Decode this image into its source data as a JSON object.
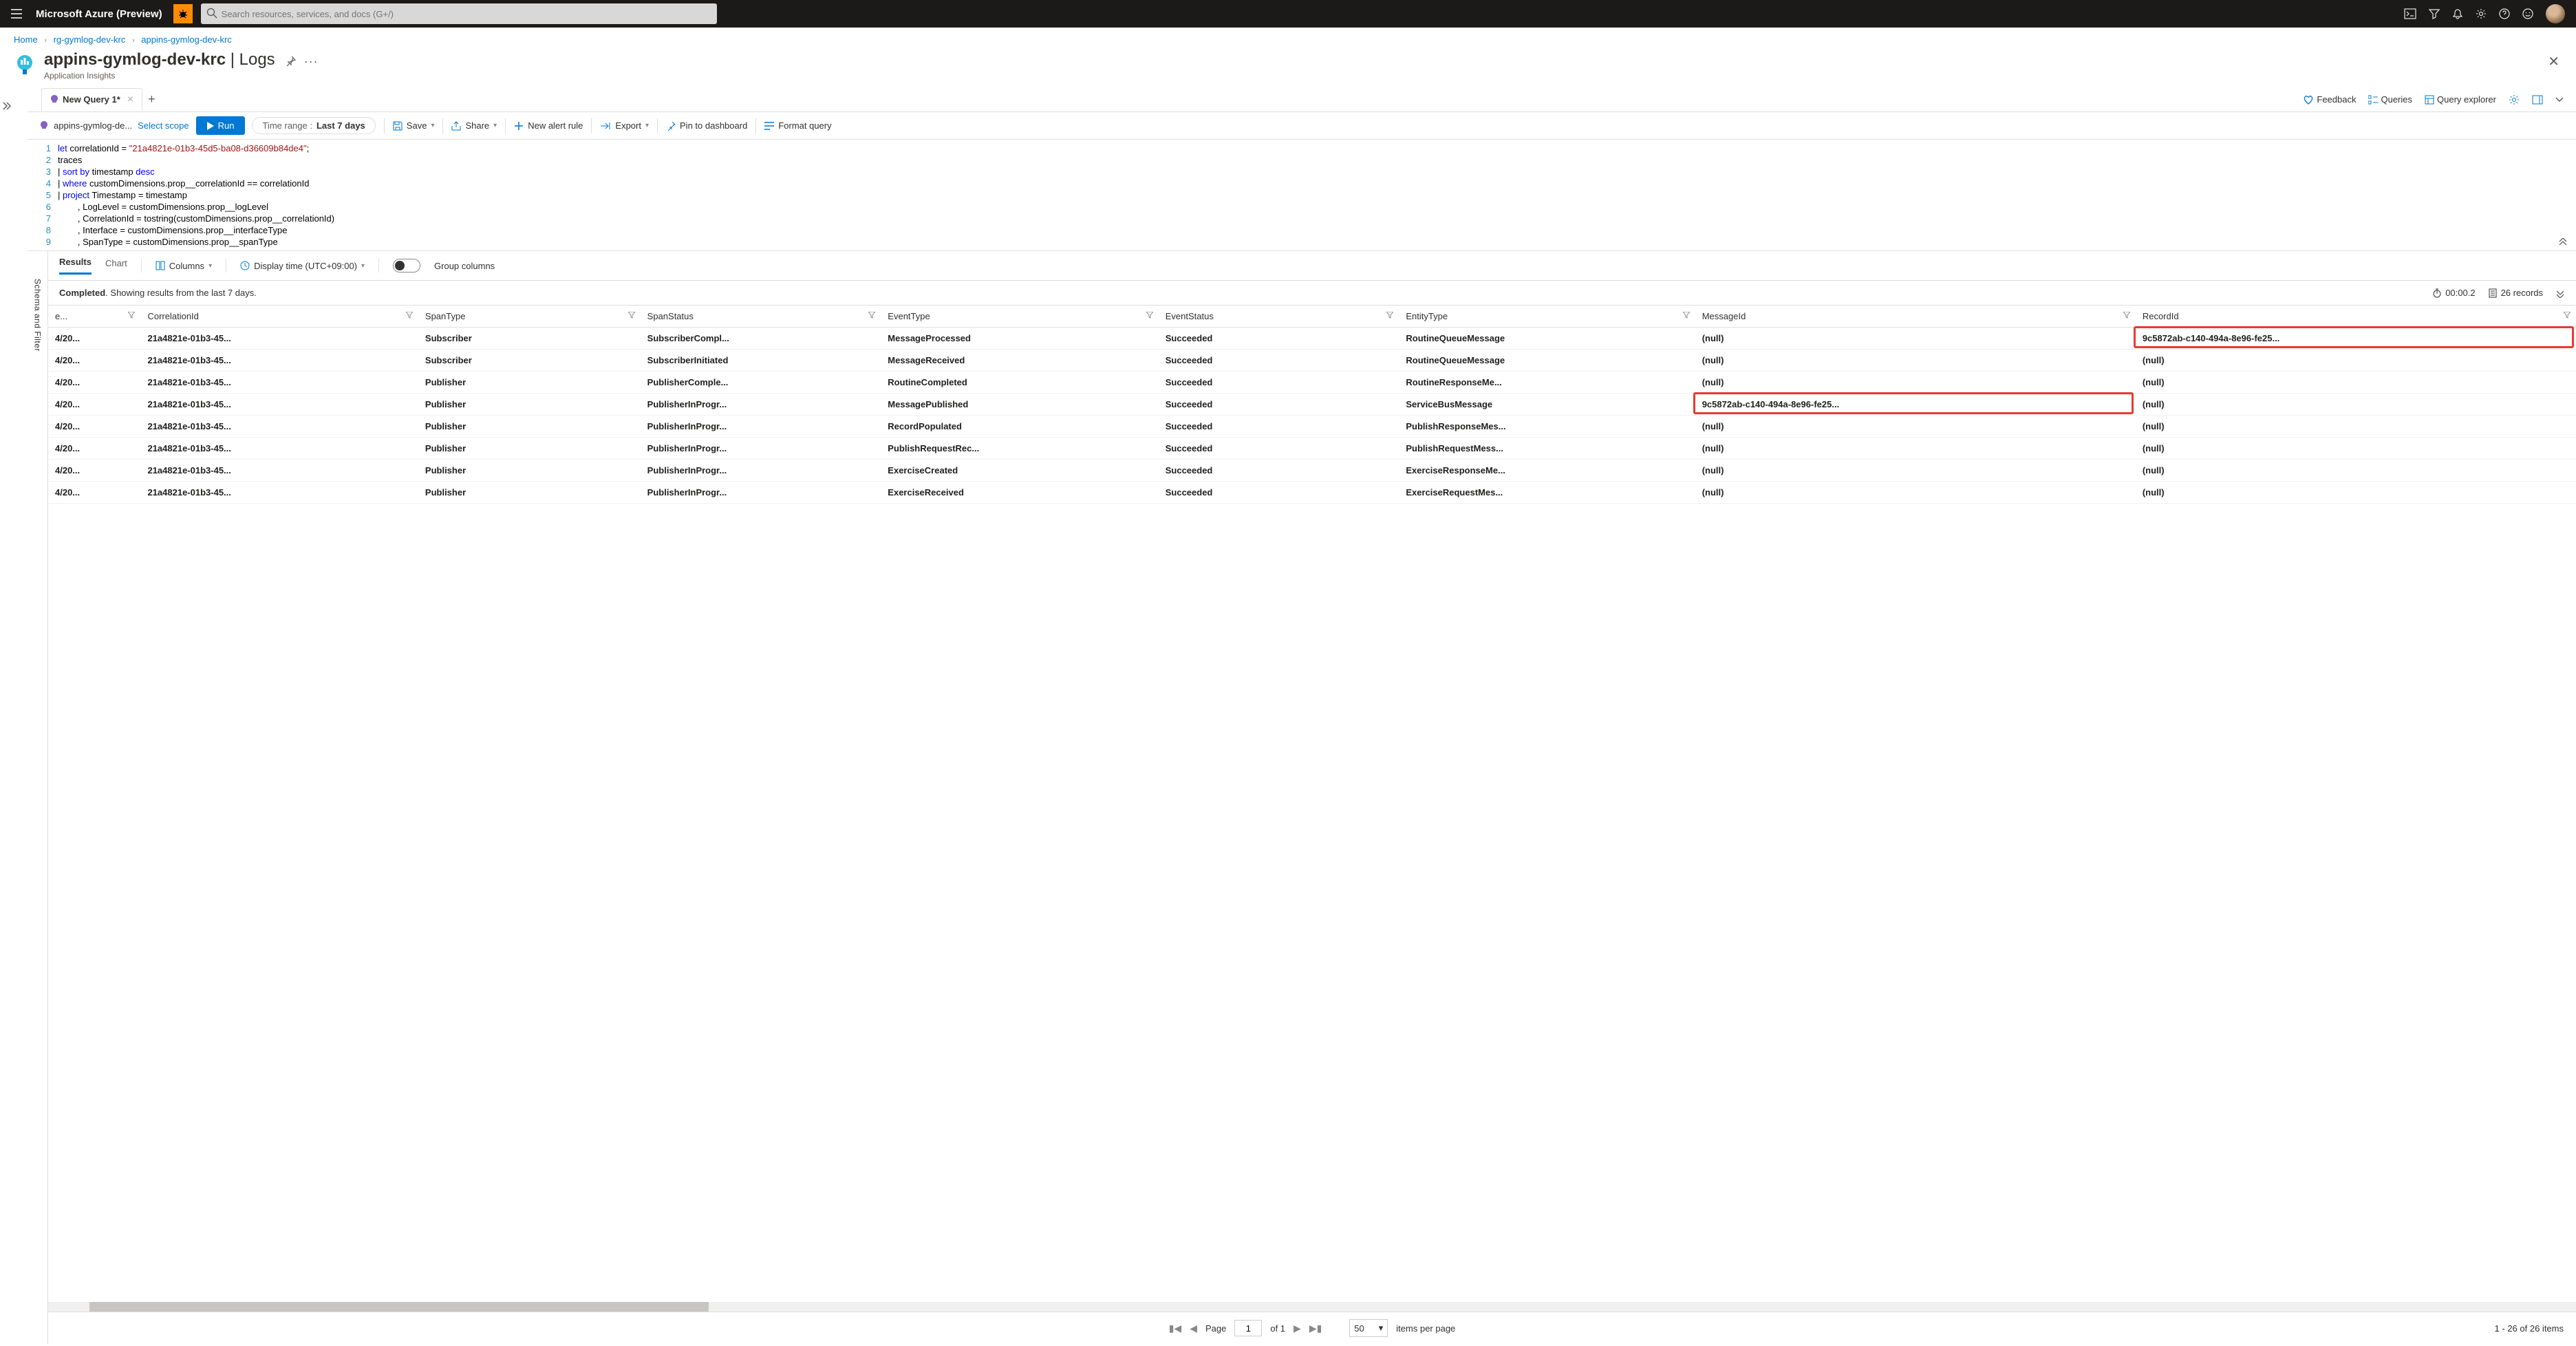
{
  "topbar": {
    "brand": "Microsoft Azure (Preview)",
    "search_placeholder": "Search resources, services, and docs (G+/)"
  },
  "breadcrumb": {
    "items": [
      "Home",
      "rg-gymlog-dev-krc",
      "appins-gymlog-dev-krc"
    ]
  },
  "page": {
    "title_main": "appins-gymlog-dev-krc",
    "title_section": "Logs",
    "subtitle": "Application Insights"
  },
  "querytab": {
    "name": "New Query 1*"
  },
  "top_actions": {
    "feedback": "Feedback",
    "queries": "Queries",
    "query_explorer": "Query explorer"
  },
  "toolbar": {
    "scope_name": "appins-gymlog-de...",
    "select_scope": "Select scope",
    "run": "Run",
    "time_label": "Time range :",
    "time_value": "Last 7 days",
    "save": "Save",
    "share": "Share",
    "new_alert": "New alert rule",
    "export": "Export",
    "pin": "Pin to dashboard",
    "format": "Format query"
  },
  "editor": {
    "lines": [
      {
        "n": "1",
        "raw": "let correlationId = \"21a4821e-01b3-45d5-ba08-d36609b84de4\";"
      },
      {
        "n": "2",
        "raw": "traces"
      },
      {
        "n": "3",
        "raw": "| sort by timestamp desc"
      },
      {
        "n": "4",
        "raw": "| where customDimensions.prop__correlationId == correlationId"
      },
      {
        "n": "5",
        "raw": "| project Timestamp = timestamp"
      },
      {
        "n": "6",
        "raw": "        , LogLevel = customDimensions.prop__logLevel"
      },
      {
        "n": "7",
        "raw": "        , CorrelationId = tostring(customDimensions.prop__correlationId)"
      },
      {
        "n": "8",
        "raw": "        , Interface = customDimensions.prop__interfaceType"
      },
      {
        "n": "9",
        "raw": "        , SpanType = customDimensions.prop__spanType"
      }
    ]
  },
  "results_tabs": {
    "results": "Results",
    "chart": "Chart",
    "columns": "Columns",
    "display_time": "Display time (UTC+09:00)",
    "group_columns": "Group columns"
  },
  "status": {
    "completed": "Completed",
    "showing": ". Showing results from the last 7 days.",
    "duration": "00:00.2",
    "records": "26 records"
  },
  "schema_rail": "Schema and Filter",
  "columns": [
    "e...",
    "CorrelationId",
    "SpanType",
    "SpanStatus",
    "EventType",
    "EventStatus",
    "EntityType",
    "MessageId",
    "RecordId"
  ],
  "rows": [
    {
      "ts": "4/20...",
      "cid": "21a4821e-01b3-45...",
      "span": "Subscriber",
      "sstat": "SubscriberCompl...",
      "etype": "MessageProcessed",
      "estat": "Succeeded",
      "ent": "RoutineQueueMessage",
      "mid": "(null)",
      "rid": "9c5872ab-c140-494a-8e96-fe25..."
    },
    {
      "ts": "4/20...",
      "cid": "21a4821e-01b3-45...",
      "span": "Subscriber",
      "sstat": "SubscriberInitiated",
      "etype": "MessageReceived",
      "estat": "Succeeded",
      "ent": "RoutineQueueMessage",
      "mid": "(null)",
      "rid": "(null)"
    },
    {
      "ts": "4/20...",
      "cid": "21a4821e-01b3-45...",
      "span": "Publisher",
      "sstat": "PublisherComple...",
      "etype": "RoutineCompleted",
      "estat": "Succeeded",
      "ent": "RoutineResponseMe...",
      "mid": "(null)",
      "rid": "(null)"
    },
    {
      "ts": "4/20...",
      "cid": "21a4821e-01b3-45...",
      "span": "Publisher",
      "sstat": "PublisherInProgr...",
      "etype": "MessagePublished",
      "estat": "Succeeded",
      "ent": "ServiceBusMessage",
      "mid": "9c5872ab-c140-494a-8e96-fe25...",
      "rid": "(null)"
    },
    {
      "ts": "4/20...",
      "cid": "21a4821e-01b3-45...",
      "span": "Publisher",
      "sstat": "PublisherInProgr...",
      "etype": "RecordPopulated",
      "estat": "Succeeded",
      "ent": "PublishResponseMes...",
      "mid": "(null)",
      "rid": "(null)"
    },
    {
      "ts": "4/20...",
      "cid": "21a4821e-01b3-45...",
      "span": "Publisher",
      "sstat": "PublisherInProgr...",
      "etype": "PublishRequestRec...",
      "estat": "Succeeded",
      "ent": "PublishRequestMess...",
      "mid": "(null)",
      "rid": "(null)"
    },
    {
      "ts": "4/20...",
      "cid": "21a4821e-01b3-45...",
      "span": "Publisher",
      "sstat": "PublisherInProgr...",
      "etype": "ExerciseCreated",
      "estat": "Succeeded",
      "ent": "ExerciseResponseMe...",
      "mid": "(null)",
      "rid": "(null)"
    },
    {
      "ts": "4/20...",
      "cid": "21a4821e-01b3-45...",
      "span": "Publisher",
      "sstat": "PublisherInProgr...",
      "etype": "ExerciseReceived",
      "estat": "Succeeded",
      "ent": "ExerciseRequestMes...",
      "mid": "(null)",
      "rid": "(null)"
    }
  ],
  "pager": {
    "page_label": "Page",
    "page_value": "1",
    "of": "of 1",
    "ipp": "50",
    "ipp_label": "items per page",
    "summary": "1 - 26 of 26 items"
  }
}
